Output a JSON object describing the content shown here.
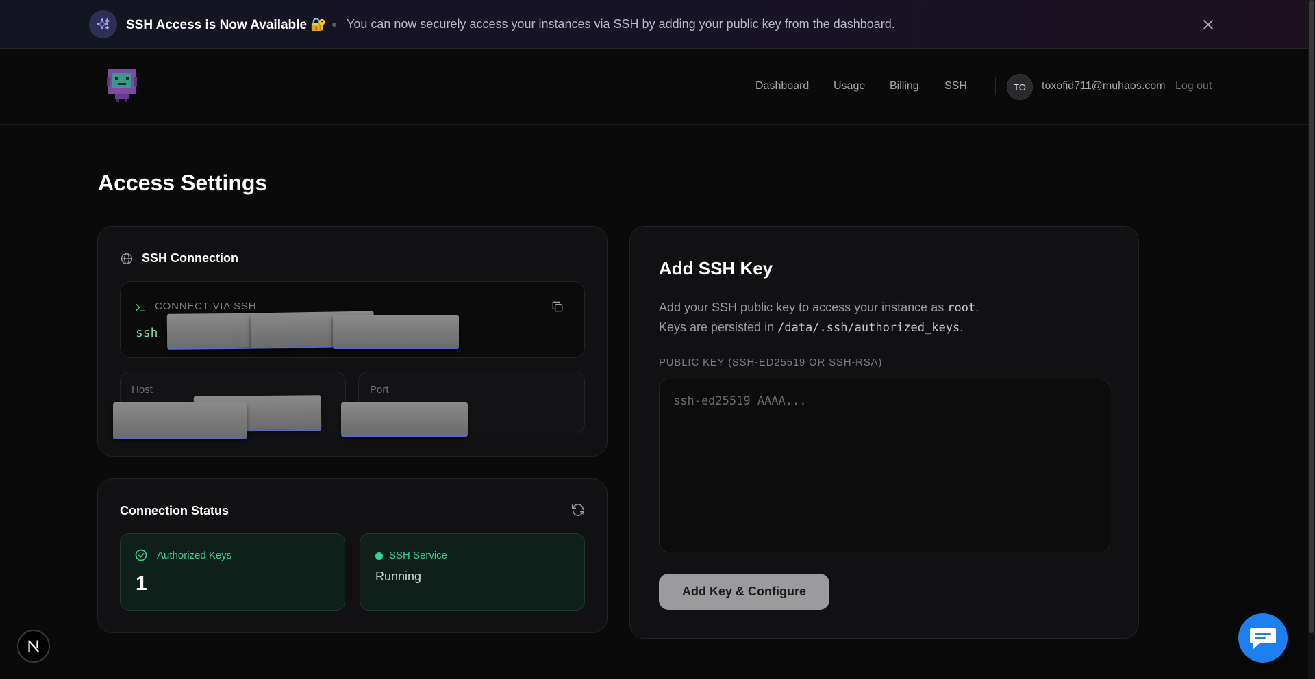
{
  "banner": {
    "title": "SSH Access is Now Available 🔐",
    "text": "You can now securely access your instances via SSH by adding your public key from the dashboard."
  },
  "header": {
    "nav": [
      "Dashboard",
      "Usage",
      "Billing",
      "SSH"
    ],
    "avatar_initials": "TO",
    "email": "toxofid711@muhaos.com",
    "logout": "Log out"
  },
  "page": {
    "title": "Access Settings"
  },
  "ssh_connection": {
    "title": "SSH Connection",
    "connect_label": "CONNECT VIA SSH",
    "command_prefix": "ssh",
    "host_label": "Host",
    "port_label": "Port"
  },
  "connection_status": {
    "title": "Connection Status",
    "authorized_keys_label": "Authorized Keys",
    "authorized_keys_count": "1",
    "ssh_service_label": "SSH Service",
    "ssh_service_status": "Running"
  },
  "add_key": {
    "title": "Add SSH Key",
    "desc_line1_pre": "Add your SSH public key to access your instance as ",
    "desc_line1_code": "root",
    "desc_line1_post": ".",
    "desc_line2_pre": "Keys are persisted in ",
    "desc_line2_code": "/data/.ssh/authorized_keys",
    "desc_line2_post": ".",
    "public_key_label": "PUBLIC KEY (SSH-ED25519 OR SSH-RSA)",
    "public_key_placeholder": "ssh-ed25519 AAAA...",
    "submit_label": "Add Key & Configure"
  },
  "colors": {
    "accent_green": "#34d399",
    "chat_blue": "#1e7ff0",
    "button_gray": "#9b9b9d"
  },
  "icons": [
    "sparkle-icon",
    "close-icon",
    "robot-logo",
    "globe-icon",
    "terminal-icon",
    "copy-icon",
    "refresh-icon",
    "check-circle-icon",
    "status-dot-icon",
    "chat-icon",
    "nextjs-icon"
  ]
}
